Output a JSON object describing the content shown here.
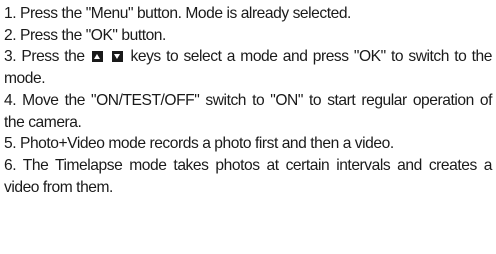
{
  "steps": [
    {
      "text": "1. Press the \"Menu\" button. Mode is already selected."
    },
    {
      "text": "2. Press the \"OK\" button."
    },
    {
      "prefix": "3. Press the",
      "suffix": "keys to select a mode and press \"OK\" to switch to the mode.",
      "icons": [
        "up-arrow-key-icon",
        "down-arrow-key-icon"
      ]
    },
    {
      "text": "4. Move the \"ON/TEST/OFF\" switch to \"ON\" to start regular operation of the camera."
    },
    {
      "text": "5. Photo+Video mode records a photo first and then a video."
    },
    {
      "text": "6. The Timelapse mode takes photos at certain intervals and creates a video from them."
    }
  ]
}
